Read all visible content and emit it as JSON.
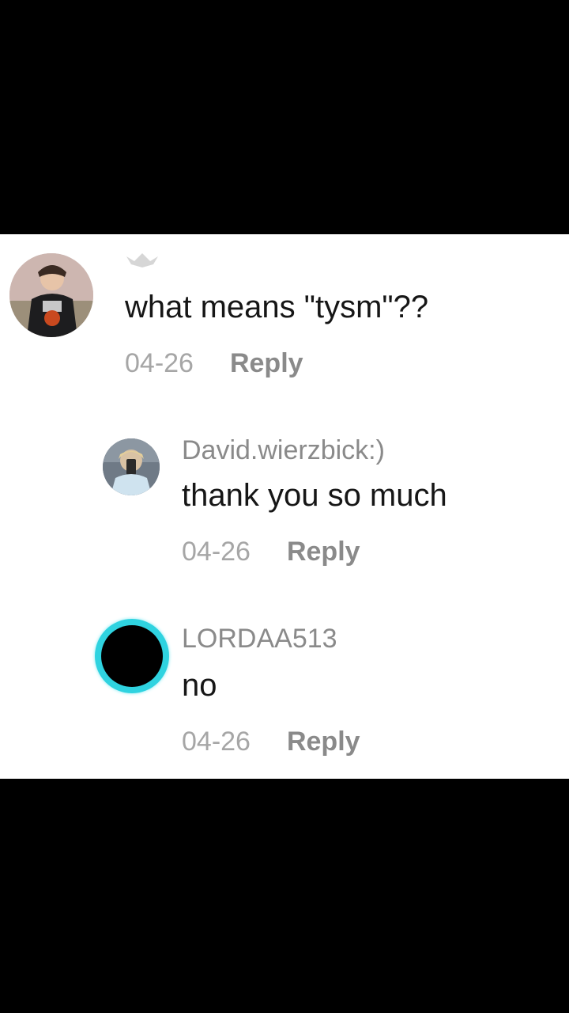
{
  "comments": [
    {
      "username": "",
      "text": "what means \"tysm\"??",
      "date": "04-26",
      "reply_label": "Reply"
    },
    {
      "username": "David.wierzbick:)",
      "text": "thank you so much",
      "date": "04-26",
      "reply_label": "Reply"
    },
    {
      "username": "LORDAA513",
      "text": "no",
      "date": "04-26",
      "reply_label": "Reply"
    }
  ],
  "colors": {
    "background": "#000000",
    "card": "#ffffff",
    "avatar_ring": "#2fd3e0",
    "text": "#161616",
    "meta": "#a6a6a6"
  }
}
